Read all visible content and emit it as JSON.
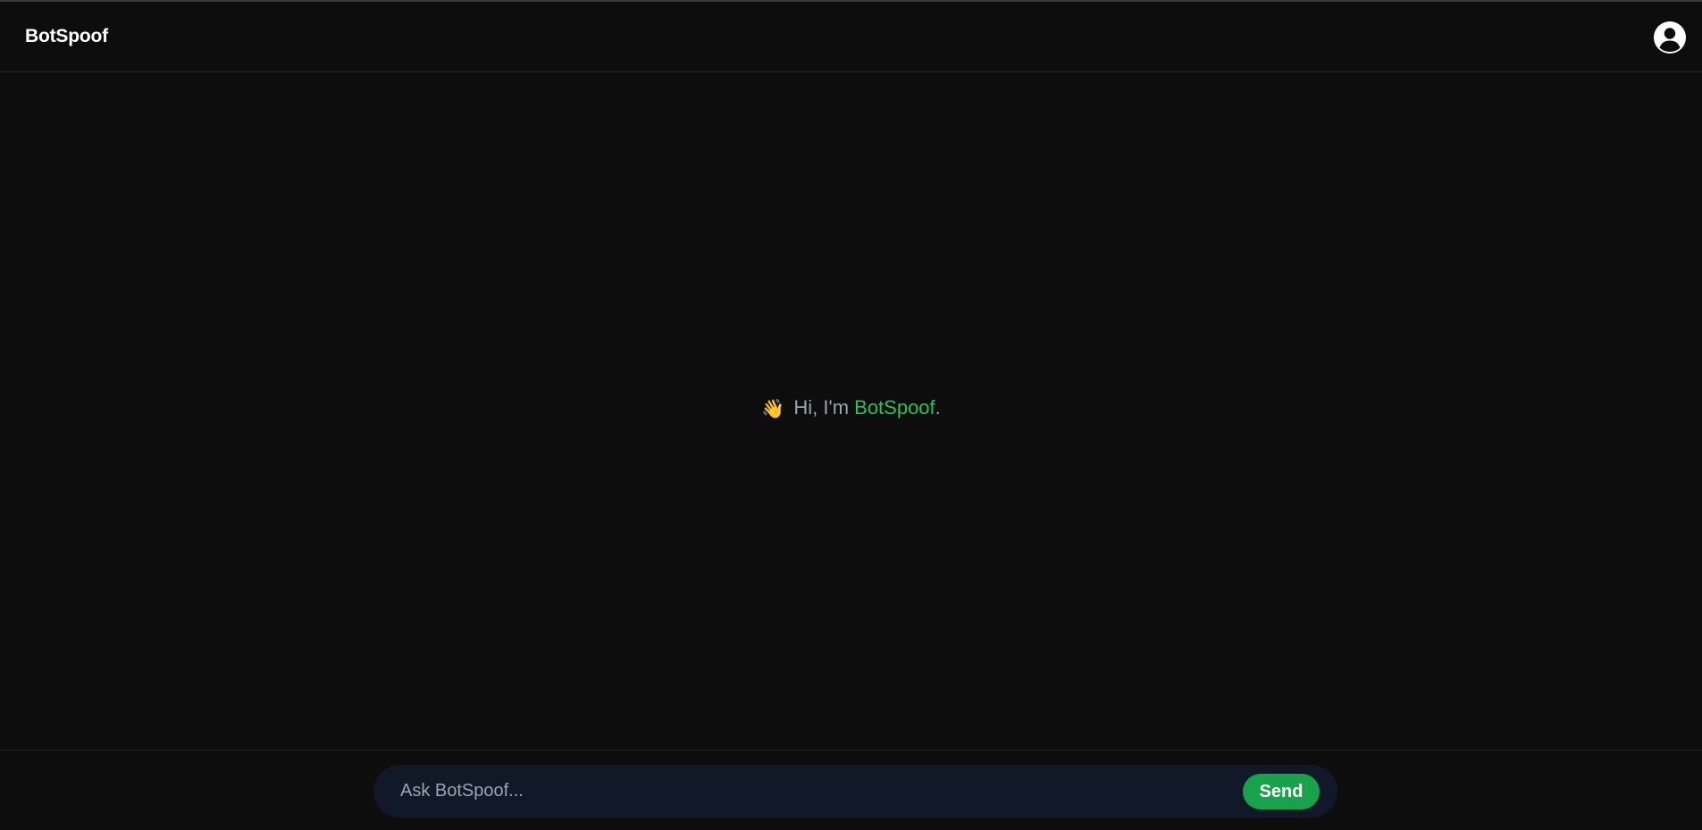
{
  "header": {
    "brand": "BotSpoof",
    "profile_icon": "user-circle-icon"
  },
  "chat": {
    "greeting_emoji": "👋",
    "greeting_prefix": "Hi, I'm ",
    "greeting_name": "BotSpoof",
    "greeting_suffix": "."
  },
  "composer": {
    "placeholder": "Ask BotSpoof...",
    "value": "",
    "send_label": "Send"
  },
  "colors": {
    "background": "#0d0d0d",
    "accent_green": "#22c55e",
    "send_button": "#16a34a",
    "composer_bg": "#111827"
  }
}
